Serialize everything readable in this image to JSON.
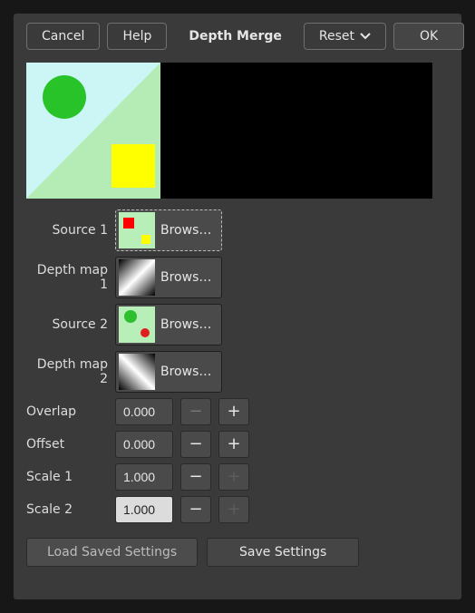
{
  "toolbar": {
    "cancel": "Cancel",
    "help": "Help",
    "title": "Depth Merge",
    "reset": "Reset",
    "ok": "OK"
  },
  "params": {
    "source1_label": "Source 1",
    "depthmap1_label": "Depth map 1",
    "source2_label": "Source 2",
    "depthmap2_label": "Depth map 2",
    "browse": "Browse..."
  },
  "spinners": {
    "overlap": {
      "label": "Overlap",
      "value": "0.000"
    },
    "offset": {
      "label": "Offset",
      "value": "0.000"
    },
    "scale1": {
      "label": "Scale 1",
      "value": "1.000"
    },
    "scale2": {
      "label": "Scale 2",
      "value": "1.000"
    }
  },
  "bottom": {
    "load": "Load Saved Settings",
    "save": "Save Settings"
  }
}
